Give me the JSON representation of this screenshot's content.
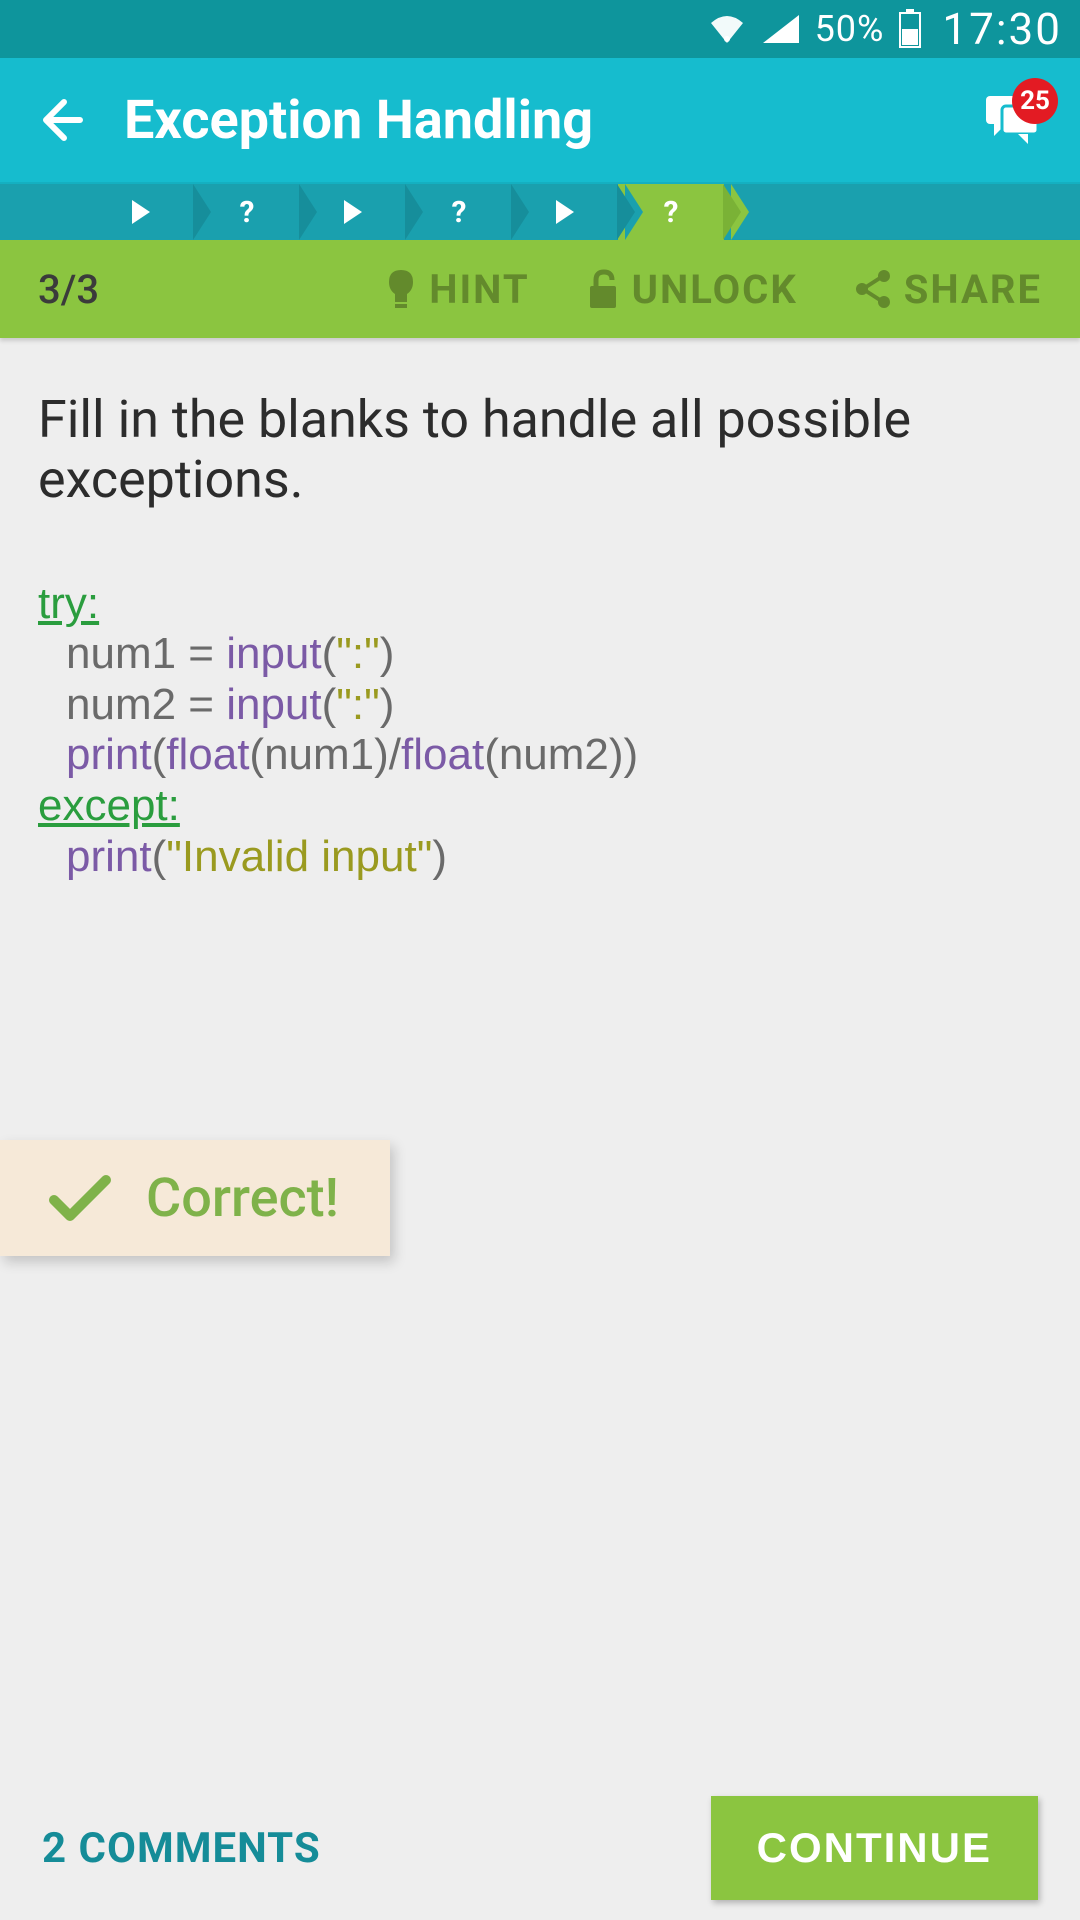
{
  "status": {
    "battery_pct": "50%",
    "time": "17:30"
  },
  "header": {
    "title": "Exception Handling",
    "notif_count": "25"
  },
  "progress": {
    "steps": [
      {
        "type": "play",
        "active": false
      },
      {
        "type": "quiz",
        "active": false
      },
      {
        "type": "play",
        "active": false
      },
      {
        "type": "quiz",
        "active": false
      },
      {
        "type": "play",
        "active": false
      },
      {
        "type": "quiz",
        "active": true
      }
    ]
  },
  "actions": {
    "counter": "3/3",
    "hint": "HINT",
    "unlock": "UNLOCK",
    "share": "SHARE"
  },
  "question": {
    "prompt": "Fill in the blanks to handle all possible exceptions.",
    "code": {
      "l1_kw": "try:",
      "l2_var": "num1 = ",
      "l2_fn": "input",
      "l2_paren_open": "(",
      "l2_str": "\":\"",
      "l2_paren_close": ")",
      "l3_var": "num2 = ",
      "l3_fn": "input",
      "l3_str": "\":\"",
      "l4_fn1": "print",
      "l4_fn2": "float",
      "l4_txt1": "(num1)/",
      "l4_fn3": "float",
      "l4_txt2": "(num2))",
      "l5_kw": "except:",
      "l6_fn": "print",
      "l6_str": "\"Invalid input\""
    }
  },
  "result": {
    "label": "Correct!"
  },
  "footer": {
    "comments": "2 COMMENTS",
    "continue": "CONTINUE"
  }
}
